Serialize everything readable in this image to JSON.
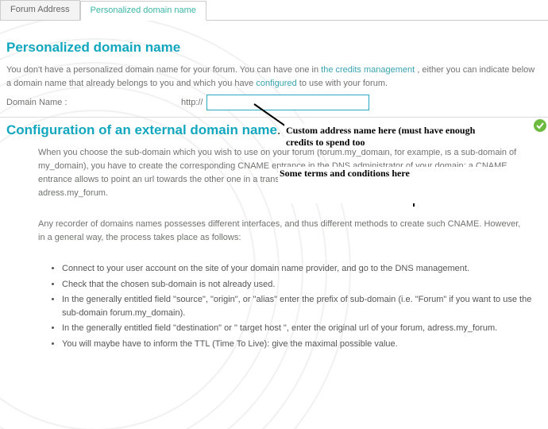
{
  "tabs": {
    "forum_address": "Forum Address",
    "personalized": "Personalized domain name"
  },
  "section1": {
    "title": "Personalized domain name",
    "intro_a": "You don't have a personalized domain name for your forum. You can have one in ",
    "credits_link": "the credits management",
    "intro_b": " , either you can indicate below a domain name that already belongs to you and which you have ",
    "configured_link": "configured",
    "intro_c": " to use with your forum.",
    "field_label": "Domain Name :",
    "prefix": "http://",
    "input_value": ""
  },
  "annotations": {
    "custom_address": "Custom address name here (must have enough credits to spend too",
    "terms": "Some terms and conditions here"
  },
  "section2": {
    "title": "Configuration of an external domain name",
    "dot": ".",
    "p1": "When you choose the sub-domain which you wish to use on your forum (forum.my_domain, for example, is a sub-domain of my_domain), you have to create the corresponding CNAME entrance in the DNS administrator of your domain: a CNAME entrance allows to point an url towards the other one in a transparent way. in this way, you can link forum.my_domain to adress.my_forum.",
    "p2": "Any recorder of domains names possesses different interfaces, and thus different methods to create such CNAME. However, in a general way, the process takes place as follows:",
    "steps": [
      "Connect to your user account on the site of your domain name provider, and go to the DNS management.",
      "Check that the chosen sub-domain is not already used.",
      "In the generally entitled field \"source\", \"origin\", or \"alias\" enter the prefix of sub-domain (i.e. \"Forum\" if you want to use the sub-domain forum.my_domain).",
      "In the generally entitled field \"destination\" or \" target host \", enter the original url of your forum, adress.my_forum.",
      "You will maybe have to inform the TTL (Time To Live): give the maximal possible value."
    ]
  }
}
